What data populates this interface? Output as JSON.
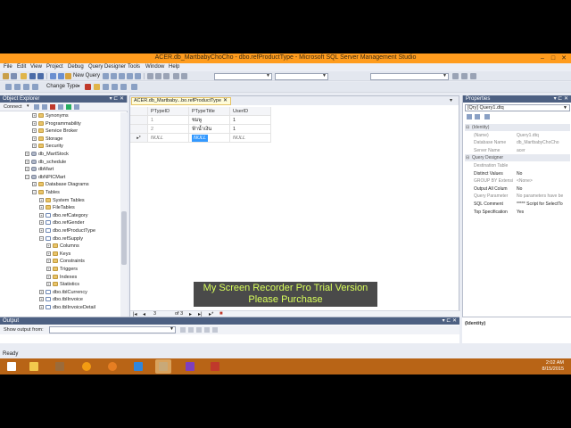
{
  "window": {
    "title": "ACER.db_MartbabyChoCho - dbo.refProductType - Microsoft SQL Server Management Studio",
    "minimize": "–",
    "maximize": "□",
    "close": "✕"
  },
  "menu": [
    "File",
    "Edit",
    "View",
    "Project",
    "Debug",
    "Query Designer",
    "Tools",
    "Window",
    "Help"
  ],
  "toolbar": {
    "new_query": "New Query",
    "change_type": "Change Type"
  },
  "object_explorer": {
    "title": "Object Explorer",
    "connect": "Connect",
    "tree": [
      {
        "label": "Synonyms",
        "icon": "folder-icon",
        "indent": 36,
        "exp": "+"
      },
      {
        "label": "Programmability",
        "icon": "folder-icon",
        "indent": 36,
        "exp": "+"
      },
      {
        "label": "Service Broker",
        "icon": "folder-icon",
        "indent": 36,
        "exp": "+"
      },
      {
        "label": "Storage",
        "icon": "folder-icon",
        "indent": 36,
        "exp": "+"
      },
      {
        "label": "Security",
        "icon": "folder-icon",
        "indent": 36,
        "exp": "+"
      },
      {
        "label": "db_MartStock",
        "icon": "database-icon",
        "indent": 28,
        "exp": "+"
      },
      {
        "label": "db_schedule",
        "icon": "database-icon",
        "indent": 28,
        "exp": "+"
      },
      {
        "label": "dbMart",
        "icon": "database-icon",
        "indent": 28,
        "exp": "+"
      },
      {
        "label": "dbNPICMart",
        "icon": "database-icon",
        "indent": 28,
        "exp": "−"
      },
      {
        "label": "Database Diagrams",
        "icon": "folder-icon",
        "indent": 36,
        "exp": "+"
      },
      {
        "label": "Tables",
        "icon": "folder-icon",
        "indent": 36,
        "exp": "−"
      },
      {
        "label": "System Tables",
        "icon": "folder-icon",
        "indent": 44,
        "exp": "+"
      },
      {
        "label": "FileTables",
        "icon": "folder-icon",
        "indent": 44,
        "exp": "+"
      },
      {
        "label": "dbo.refCategory",
        "icon": "table-icon",
        "indent": 44,
        "exp": "+"
      },
      {
        "label": "dbo.refGender",
        "icon": "table-icon",
        "indent": 44,
        "exp": "+"
      },
      {
        "label": "dbo.refProductType",
        "icon": "table-icon",
        "indent": 44,
        "exp": "+"
      },
      {
        "label": "dbo.refSupply",
        "icon": "table-icon",
        "indent": 44,
        "exp": "−"
      },
      {
        "label": "Columns",
        "icon": "folder-icon",
        "indent": 52,
        "exp": "+"
      },
      {
        "label": "Keys",
        "icon": "folder-icon",
        "indent": 52,
        "exp": "+"
      },
      {
        "label": "Constraints",
        "icon": "folder-icon",
        "indent": 52,
        "exp": "+"
      },
      {
        "label": "Triggers",
        "icon": "folder-icon",
        "indent": 52,
        "exp": "+"
      },
      {
        "label": "Indexes",
        "icon": "folder-icon",
        "indent": 52,
        "exp": "+"
      },
      {
        "label": "Statistics",
        "icon": "folder-icon",
        "indent": 52,
        "exp": "+"
      },
      {
        "label": "dbo.tblCurrency",
        "icon": "table-icon",
        "indent": 44,
        "exp": "+"
      },
      {
        "label": "dbo.tblInvoice",
        "icon": "table-icon",
        "indent": 44,
        "exp": "+"
      },
      {
        "label": "dbo.tblInvoiceDetail",
        "icon": "table-icon",
        "indent": 44,
        "exp": "+"
      }
    ]
  },
  "document": {
    "tab_label": "ACER.db_Martbaby...bo.refProductType",
    "columns": [
      "PTypeID",
      "PTypeTitle",
      "UserID"
    ],
    "rows": [
      {
        "marker": "",
        "cells": [
          "1",
          "ชมพู",
          "1"
        ]
      },
      {
        "marker": "",
        "cells": [
          "2",
          "ฟ้าน้ำเงิน",
          "1"
        ]
      },
      {
        "marker": "▸*",
        "cells": [
          "NULL",
          "NULL",
          "NULL"
        ]
      }
    ],
    "nav": {
      "current": "3",
      "of_text": "of 3"
    }
  },
  "properties": {
    "title": "Properties",
    "selector": "[Qry] Query1.dtq",
    "rows": [
      {
        "name": "(Identity)",
        "value": "",
        "type": "cat"
      },
      {
        "name": "(Name)",
        "value": "Query1.dtq",
        "type": "gray"
      },
      {
        "name": "Database Name",
        "value": "db_MartbabyChoCho",
        "type": "gray"
      },
      {
        "name": "Server Name",
        "value": "acer",
        "type": "gray"
      },
      {
        "name": "Query Designer",
        "value": "",
        "type": "cat"
      },
      {
        "name": "Destination Table",
        "value": "",
        "type": "gray"
      },
      {
        "name": "Distinct Values",
        "value": "No",
        "type": ""
      },
      {
        "name": "GROUP BY Extensi",
        "value": "<None>",
        "type": "gray"
      },
      {
        "name": "Output All Colum",
        "value": "No",
        "type": ""
      },
      {
        "name": "Query Parameter",
        "value": "No parameters have be",
        "type": "gray"
      },
      {
        "name": "SQL Comment",
        "value": "***** Script for SelectTo",
        "type": ""
      },
      {
        "name": "Top Specification",
        "value": "Yes",
        "type": ""
      }
    ],
    "desc_title": "(Identity)"
  },
  "output": {
    "title": "Output",
    "show_from": "Show output from:"
  },
  "status": "Ready",
  "watermark": {
    "line1": "My Screen Recorder Pro Trial Version",
    "line2": "Please Purchase"
  },
  "tray": {
    "time": "2:02 AM",
    "date": "8/15/2015"
  },
  "taskbar_icons": [
    {
      "name": "windows-start-icon",
      "color": "#ffffff"
    },
    {
      "name": "file-explorer-icon",
      "color": "#f2c94c"
    },
    {
      "name": "media-icon",
      "color": "#9b6b3a"
    },
    {
      "name": "browser-orb-icon",
      "color": "#f39c12"
    },
    {
      "name": "firefox-icon",
      "color": "#e67e22"
    },
    {
      "name": "internet-explorer-icon",
      "color": "#2e86de"
    },
    {
      "name": "ssms-icon",
      "color": "#c8a978"
    },
    {
      "name": "visual-studio-icon",
      "color": "#7e3fbf"
    },
    {
      "name": "recorder-icon",
      "color": "#c0392b"
    }
  ],
  "colors": {
    "accent": "#ff9c1e",
    "taskbar": "#b86416",
    "panel_header": "#4d6082"
  }
}
